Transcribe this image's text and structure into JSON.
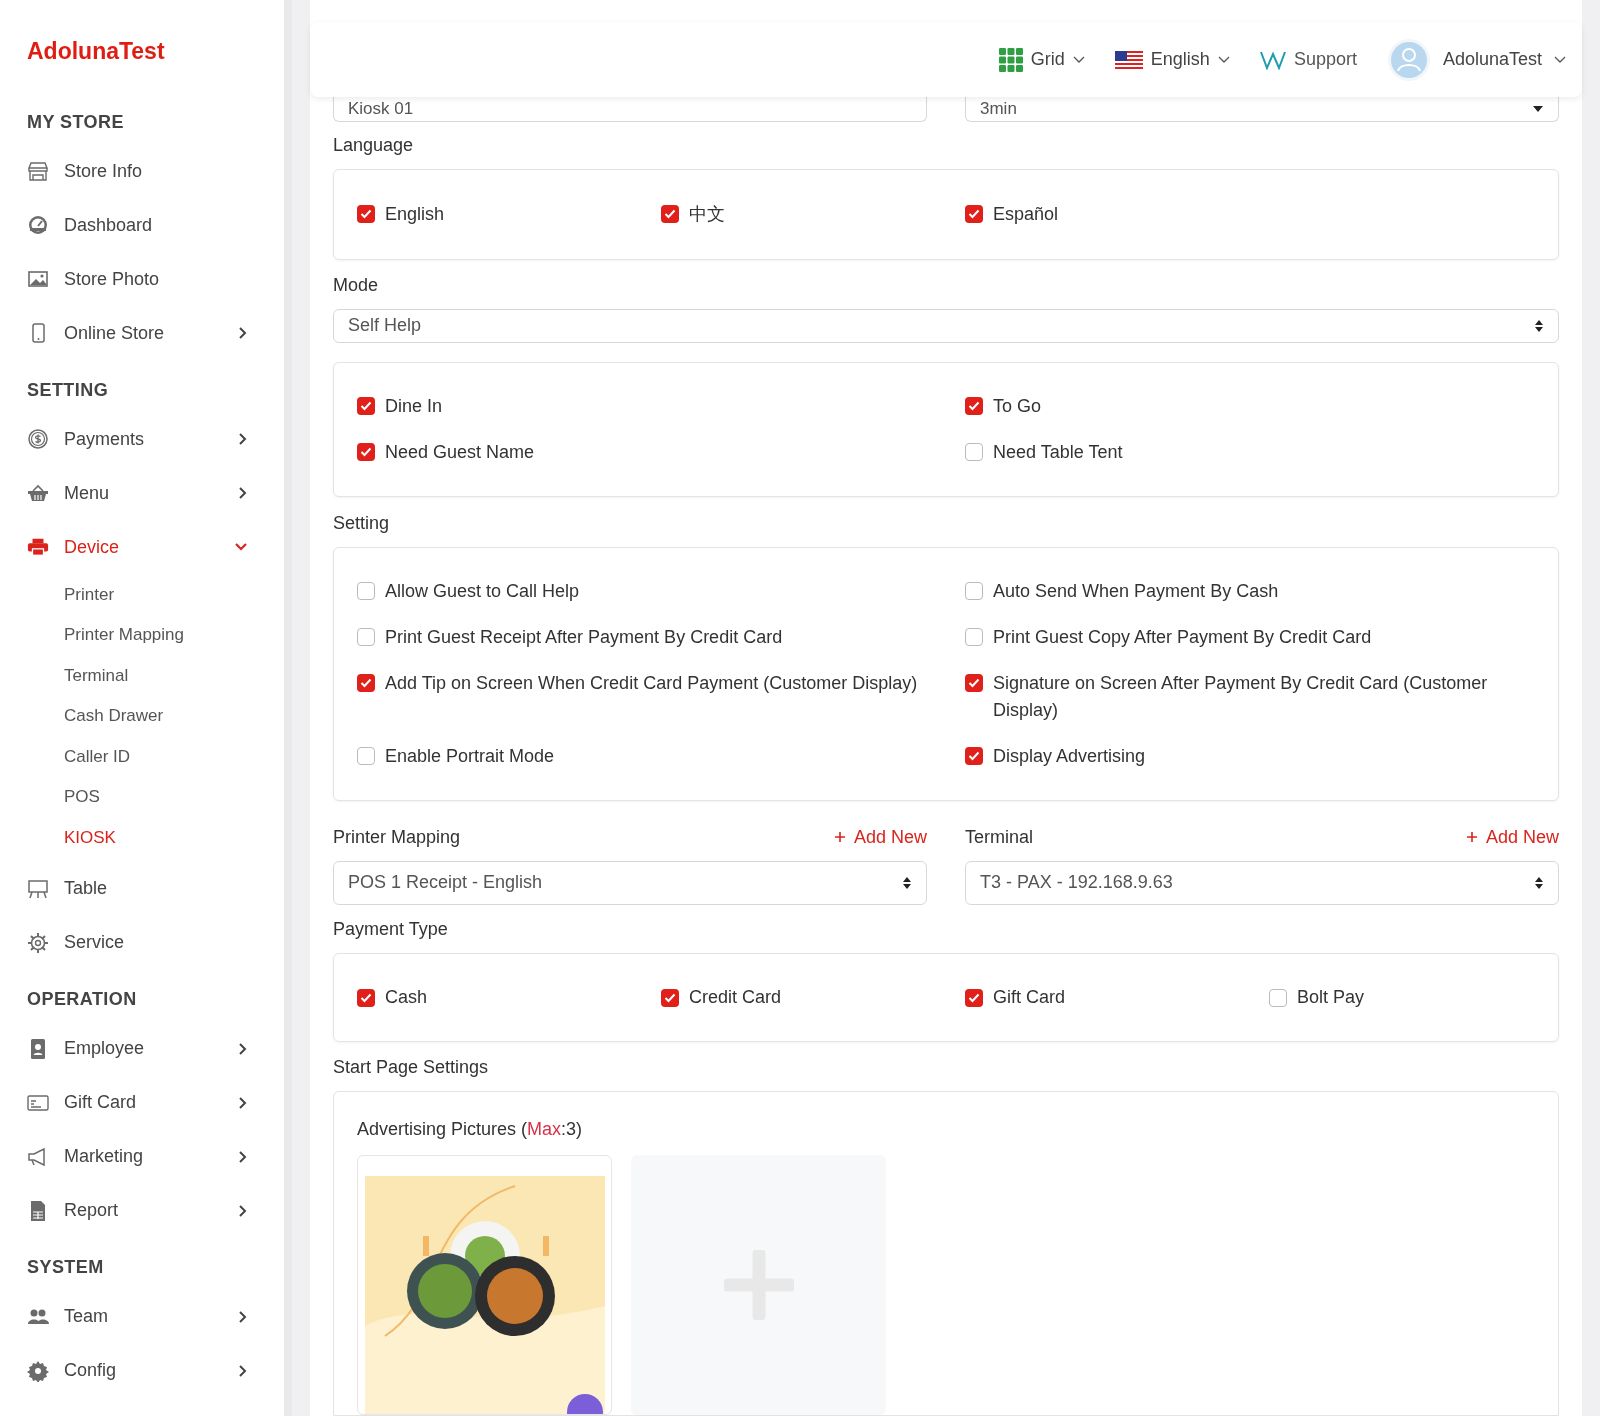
{
  "brand": "AdolunaTest",
  "header": {
    "grid": "Grid",
    "language": "English",
    "support": "Support",
    "user": "AdolunaTest"
  },
  "sidebar": {
    "sections": [
      {
        "title": "MY STORE",
        "items": [
          {
            "label": "Store Info",
            "selected": false
          },
          {
            "label": "Dashboard",
            "selected": false
          },
          {
            "label": "Store Photo",
            "selected": false
          },
          {
            "label": "Online Store",
            "selected": false,
            "expanded": false
          }
        ]
      },
      {
        "title": "SETTING",
        "items": [
          {
            "label": "Payments",
            "selected": false,
            "expanded": false
          },
          {
            "label": "Menu",
            "selected": false,
            "expanded": false
          },
          {
            "label": "Device",
            "selected": true,
            "expanded": true,
            "children": [
              {
                "label": "Printer",
                "selected": false
              },
              {
                "label": "Printer Mapping",
                "selected": false
              },
              {
                "label": "Terminal",
                "selected": false
              },
              {
                "label": "Cash Drawer",
                "selected": false
              },
              {
                "label": "Caller ID",
                "selected": false
              },
              {
                "label": "POS",
                "selected": false
              },
              {
                "label": "KIOSK",
                "selected": true
              }
            ]
          },
          {
            "label": "Table",
            "selected": false
          },
          {
            "label": "Service",
            "selected": false
          }
        ]
      },
      {
        "title": "OPERATION",
        "items": [
          {
            "label": "Employee",
            "selected": false,
            "expanded": false
          },
          {
            "label": "Gift Card",
            "selected": false,
            "expanded": false
          },
          {
            "label": "Marketing",
            "selected": false,
            "expanded": false
          },
          {
            "label": "Report",
            "selected": false,
            "expanded": false
          }
        ]
      },
      {
        "title": "SYSTEM",
        "items": [
          {
            "label": "Team",
            "selected": false,
            "expanded": false
          },
          {
            "label": "Config",
            "selected": false,
            "expanded": false
          }
        ]
      }
    ]
  },
  "top_fields": [
    {
      "kind": "text",
      "value": "Kiosk 01"
    },
    {
      "kind": "select",
      "value": "3min"
    }
  ],
  "language": {
    "label": "Language",
    "options": [
      {
        "label": "English",
        "checked": true
      },
      {
        "label": "中文",
        "checked": true
      },
      {
        "label": "Español",
        "checked": true
      }
    ]
  },
  "mode": {
    "label": "Mode",
    "value": "Self Help",
    "options": [
      {
        "label": "Dine In",
        "checked": true
      },
      {
        "label": "To Go",
        "checked": true
      },
      {
        "label": "Need Guest Name",
        "checked": true
      },
      {
        "label": "Need Table Tent",
        "checked": false
      }
    ]
  },
  "setting": {
    "label": "Setting",
    "options": [
      {
        "label": "Allow Guest to Call Help",
        "checked": false
      },
      {
        "label": "Auto Send When Payment By Cash",
        "checked": false
      },
      {
        "label": "Print Guest Receipt After Payment By Credit Card",
        "checked": false
      },
      {
        "label": "Print Guest Copy After Payment By Credit Card",
        "checked": false
      },
      {
        "label": "Add Tip on Screen When Credit Card Payment (Customer Display)",
        "checked": true
      },
      {
        "label": "Signature on Screen After Payment By Credit Card (Customer Display)",
        "checked": true
      },
      {
        "label": "Enable Portrait Mode",
        "checked": false
      },
      {
        "label": "Display Advertising",
        "checked": true
      }
    ]
  },
  "selects": [
    {
      "label": "Printer Mapping",
      "add_label": "Add New",
      "value": "POS 1 Receipt - English"
    },
    {
      "label": "Terminal",
      "add_label": "Add New",
      "value": "T3 - PAX - 192.168.9.63"
    }
  ],
  "payment_type": {
    "label": "Payment Type",
    "options": [
      {
        "label": "Cash",
        "checked": true
      },
      {
        "label": "Credit Card",
        "checked": true
      },
      {
        "label": "Gift Card",
        "checked": true
      },
      {
        "label": "Bolt Pay",
        "checked": false
      }
    ]
  },
  "start_page": {
    "label": "Start Page Settings",
    "advertising": {
      "prefix": "Advertising Pictures (",
      "highlight": "Max",
      "suffix": ":3)"
    },
    "pictures": [
      {
        "kind": "picture"
      },
      {
        "kind": "upload"
      }
    ]
  }
}
